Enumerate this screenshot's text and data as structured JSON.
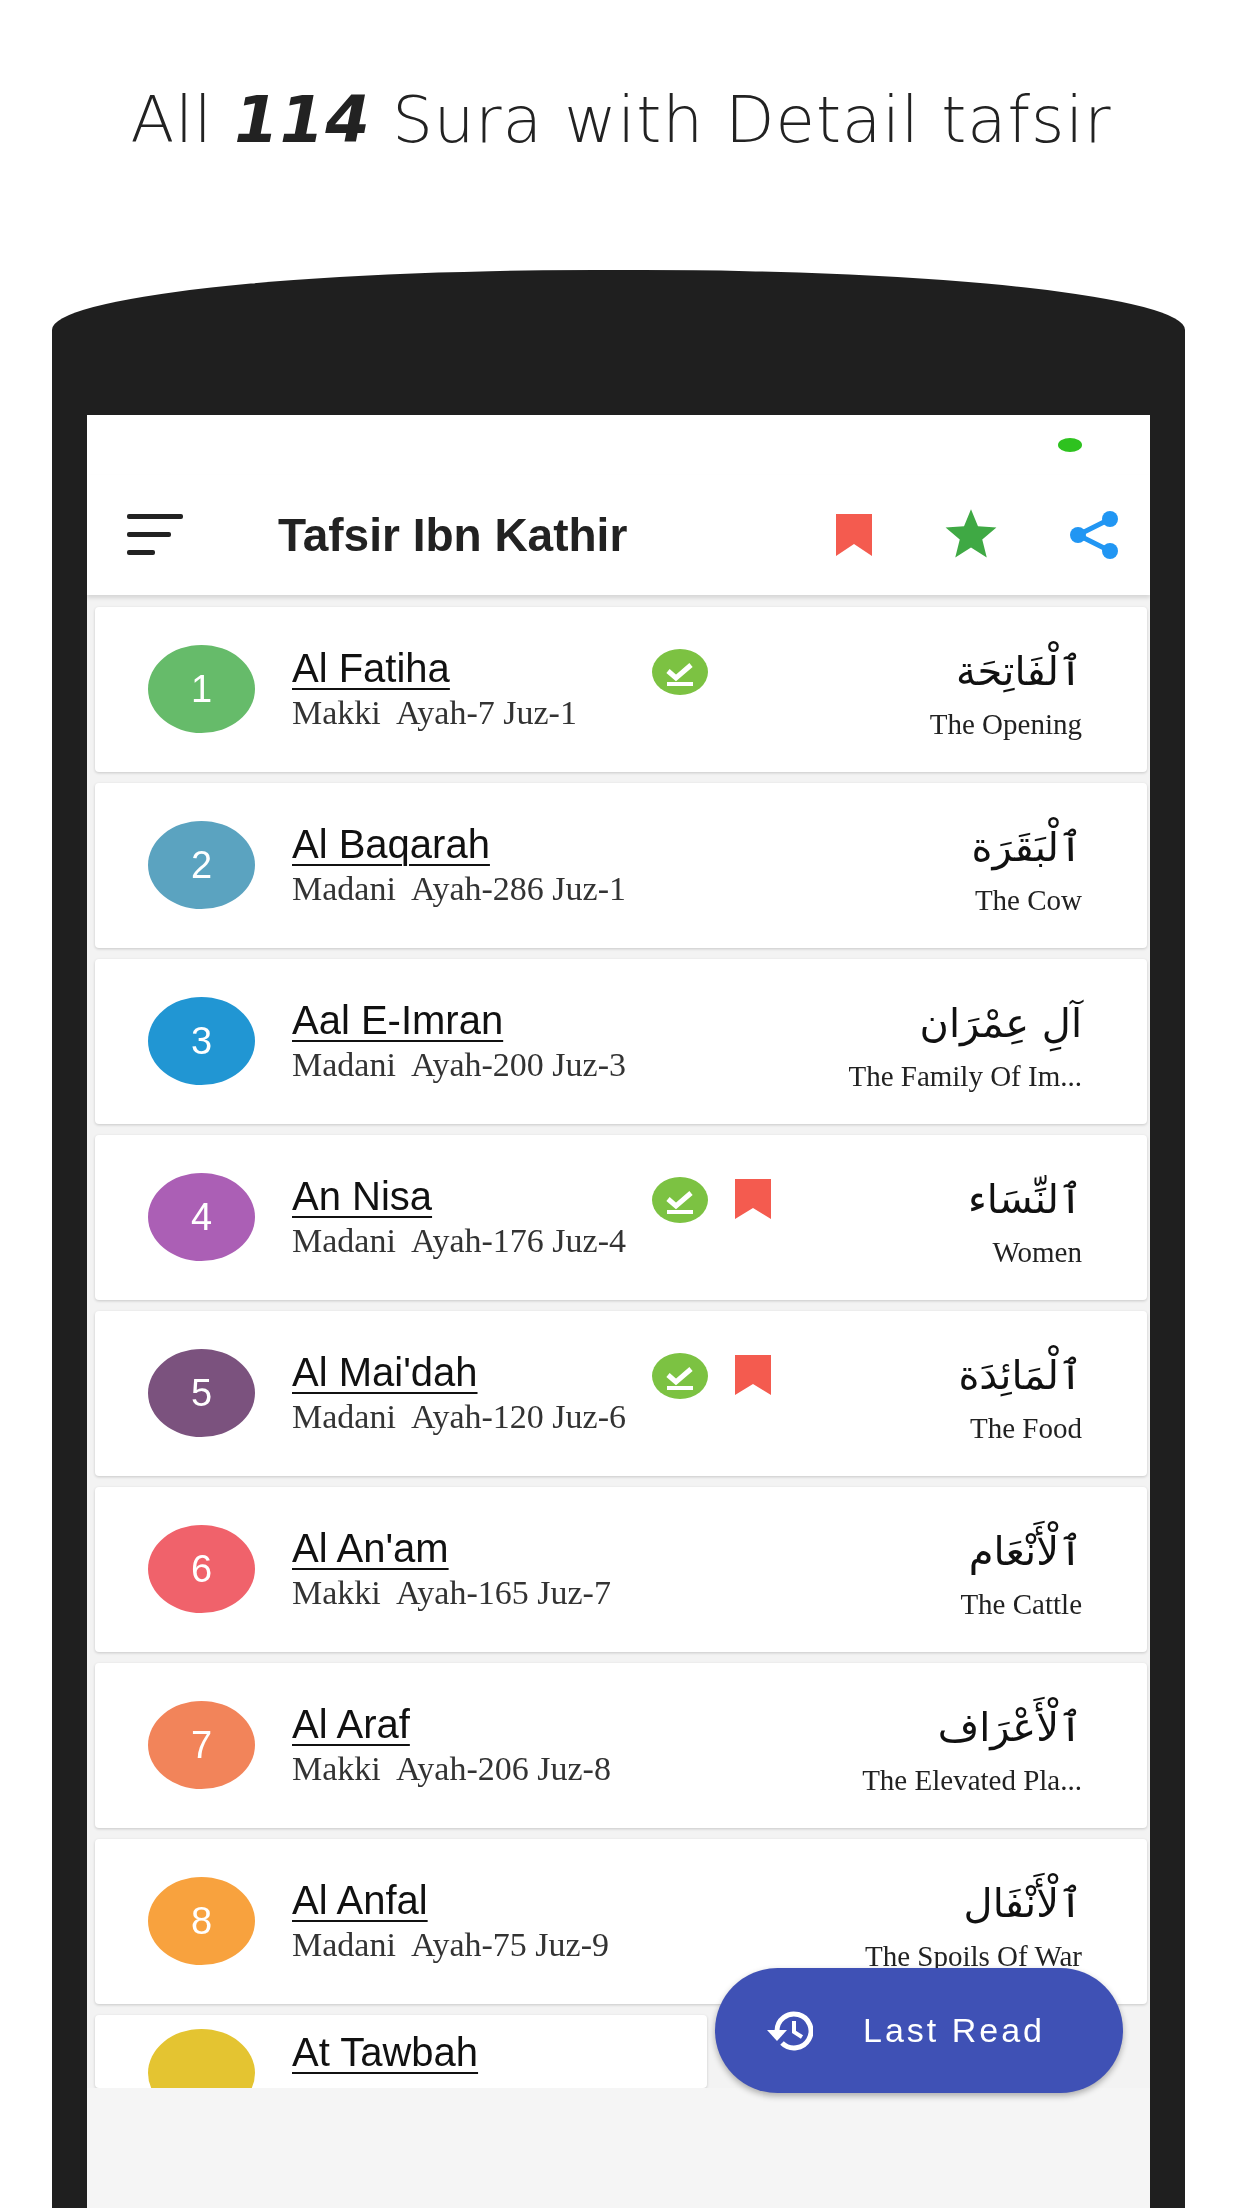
{
  "headline": "All **114** Sura with Detail tafsir",
  "app_bar": {
    "title": "Tafsir Ibn Kathir"
  },
  "suras": [
    {
      "number": "1",
      "name": "Al Fatiha",
      "meta": "Makki  Ayah-7 Juz-1",
      "arabic": "ٱلْفَاتِحَة",
      "english": "The Opening",
      "color": "#66bb6a",
      "read": true,
      "bookmarked": false
    },
    {
      "number": "2",
      "name": "Al Baqarah",
      "meta": "Madani  Ayah-286 Juz-1",
      "arabic": "ٱلْبَقَرَة",
      "english": "The Cow",
      "color": "#5ba3c0",
      "read": false,
      "bookmarked": false
    },
    {
      "number": "3",
      "name": "Aal E-Imran",
      "meta": "Madani  Ayah-200 Juz-3",
      "arabic": "آلِ عِمْرَان",
      "english": "The Family Of Im...",
      "color": "#2196d3",
      "read": false,
      "bookmarked": false
    },
    {
      "number": "4",
      "name": "An Nisa",
      "meta": "Madani  Ayah-176 Juz-4",
      "arabic": "ٱلنِّسَاء",
      "english": "Women",
      "color": "#ab5fb5",
      "read": true,
      "bookmarked": true
    },
    {
      "number": "5",
      "name": "Al Mai'dah",
      "meta": "Madani  Ayah-120 Juz-6",
      "arabic": "ٱلْمَائِدَة",
      "english": "The Food",
      "color": "#7b527e",
      "read": true,
      "bookmarked": true
    },
    {
      "number": "6",
      "name": "Al An'am",
      "meta": "Makki  Ayah-165 Juz-7",
      "arabic": "ٱلْأَنْعَام",
      "english": "The Cattle",
      "color": "#f0626b",
      "read": false,
      "bookmarked": false
    },
    {
      "number": "7",
      "name": "Al Araf",
      "meta": "Makki  Ayah-206 Juz-8",
      "arabic": "ٱلْأَعْرَاف",
      "english": "The Elevated Pla...",
      "color": "#f2845a",
      "read": false,
      "bookmarked": false
    },
    {
      "number": "8",
      "name": "Al Anfal",
      "meta": "Madani  Ayah-75 Juz-9",
      "arabic": "ٱلْأَنْفَال",
      "english": "The Spoils Of War",
      "color": "#f8a23e",
      "read": false,
      "bookmarked": false
    },
    {
      "name": "At Tawbah",
      "color": "#e4c431",
      "read": false,
      "bookmarked": false
    }
  ],
  "fab": {
    "label": "Last Read"
  }
}
